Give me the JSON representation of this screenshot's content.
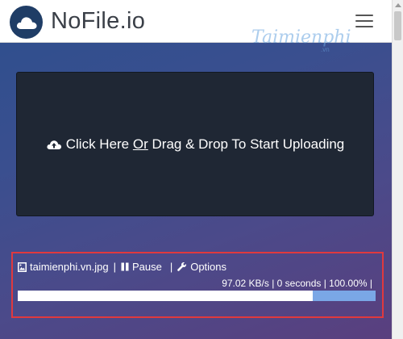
{
  "header": {
    "brand": "NoFile.io",
    "watermark": "Taimienphi",
    "watermark_sub": ".vn"
  },
  "dropzone": {
    "text_before": "Click Here",
    "text_or": "Or",
    "text_after": "Drag & Drop To Start Uploading"
  },
  "upload": {
    "filename": "taimienphi.vn.jpg",
    "pause_label": "Pause",
    "options_label": "Options",
    "stats": "97.02 KB/s | 0 seconds | 100.00% |",
    "progress": 1.0
  },
  "colors": {
    "header_bg": "#ffffff",
    "logo_bg": "#1f3d66",
    "dropzone_bg": "#1f2734",
    "highlight_border": "#e0393e",
    "progress_accent": "#7aa7e6"
  },
  "icons": {
    "logo": "cloud-icon",
    "menu": "hamburger-icon",
    "upload": "cloud-upload-icon",
    "file": "image-file-icon",
    "pause": "pause-icon",
    "options": "wrench-icon"
  }
}
